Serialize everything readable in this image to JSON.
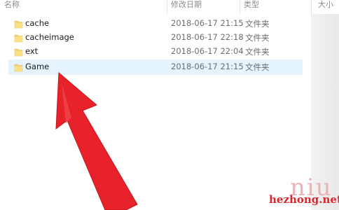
{
  "columns": {
    "name": "名称",
    "modified": "修改日期",
    "type": "类型",
    "size": "大小"
  },
  "files": [
    {
      "name": "cache",
      "modified": "2018-06-17 21:15",
      "type": "文件夹",
      "icon": "folder-icon"
    },
    {
      "name": "cacheimage",
      "modified": "2018-06-17 22:18",
      "type": "文件夹",
      "icon": "folder-icon"
    },
    {
      "name": "ext",
      "modified": "2018-06-17 22:04",
      "type": "文件夹",
      "icon": "folder-icon"
    },
    {
      "name": "Game",
      "modified": "2018-06-17 21:15",
      "type": "文件夹",
      "icon": "folder-icon",
      "selected": true
    }
  ],
  "annotation": {
    "pointer": "red-arrow",
    "color": "#e8222a"
  },
  "watermark": {
    "brand": "niu",
    "url": "hezhong.net"
  },
  "colors": {
    "selection": "#e5f3ff",
    "folder": "#f6d068"
  }
}
